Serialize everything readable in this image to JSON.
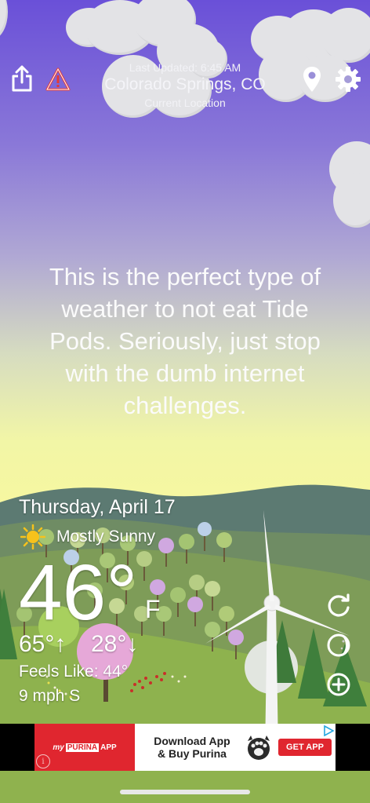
{
  "header": {
    "last_updated": "Last Updated: 6:45 AM",
    "location": "Colorado Springs, CO",
    "location_sub": "Current Location"
  },
  "message": "This is the perfect type of weather to not eat Tide Pods. Seriously, just stop with the dumb internet challenges.",
  "weather": {
    "date": "Thursday, April 17",
    "condition": "Mostly Sunny",
    "temperature": "46°",
    "unit": "F",
    "high": "65°↑",
    "low": "28°↓",
    "feels_like": "Feels Like: 44°",
    "wind": "9 mph S"
  },
  "ad": {
    "brand_prefix": "my",
    "brand": "PURINA",
    "brand_suffix": "APP",
    "headline_line1": "Download App",
    "headline_line2": "& Buy Purina",
    "cta": "GET APP",
    "info_glyph": "i"
  },
  "colors": {
    "sky_top": "#6a50d8",
    "sky_bottom": "#f6f7a0",
    "hill_back": "#5a7a70",
    "hill_mid": "#7f9b62",
    "grass": "#8fb650",
    "ad_red": "#e0262f"
  },
  "icons": [
    "share-icon",
    "alert-triangle-icon",
    "location-pin-icon",
    "settings-gear-icon",
    "refresh-icon",
    "moon-phase-icon",
    "add-icon",
    "sun-icon",
    "adchoices-icon",
    "info-icon"
  ]
}
